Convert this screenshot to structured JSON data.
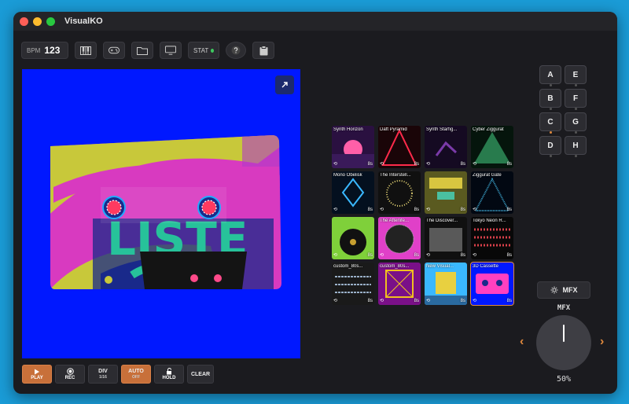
{
  "window": {
    "title": "VisualKO"
  },
  "toolbar": {
    "bpm_label": "BPM",
    "bpm_value": "123",
    "stat_label": "STAT",
    "buttons": [
      "piano-icon",
      "gamepad-icon",
      "folder-icon",
      "monitor-icon",
      "help-icon",
      "clipboard-icon"
    ]
  },
  "thumbnails": [
    {
      "name": "Synth Horizon",
      "duration": "8s",
      "colors": [
        "#2a1040",
        "#ff5fa8"
      ]
    },
    {
      "name": "Daft Pyramid",
      "duration": "8s",
      "colors": [
        "#1a0508",
        "#ff2a4a"
      ]
    },
    {
      "name": "Synth Starfig...",
      "duration": "8s",
      "colors": [
        "#150a22",
        "#7a3aa8"
      ]
    },
    {
      "name": "Cyber Ziggurat",
      "duration": "8s",
      "colors": [
        "#05150c",
        "#3fc07a"
      ]
    },
    {
      "name": "Mono Obelisk",
      "duration": "8s",
      "colors": [
        "#04101f",
        "#3ab8ff"
      ]
    },
    {
      "name": "The Interstell...",
      "duration": "8s",
      "colors": [
        "#101010",
        "#f2e07a"
      ]
    },
    {
      "name": "",
      "duration": "8s",
      "colors": [
        "#5a5a20",
        "#d8c640"
      ]
    },
    {
      "name": "Ziggurat Gate",
      "duration": "8s",
      "colors": [
        "#020812",
        "#3aa0c8"
      ]
    },
    {
      "name": "",
      "duration": "8s",
      "colors": [
        "#7fd03a",
        "#111111"
      ]
    },
    {
      "name": "The Afterlife...",
      "duration": "8s",
      "colors": [
        "#e040c8",
        "#222222"
      ]
    },
    {
      "name": "The Discover...",
      "duration": "8s",
      "colors": [
        "#101010",
        "#8a8a8a"
      ]
    },
    {
      "name": "Tokyo Neon R...",
      "duration": "8s",
      "colors": [
        "#080808",
        "#d8404a"
      ]
    },
    {
      "name": "custom_80s...",
      "duration": "8s",
      "colors": [
        "#1a1a1a",
        "#9ab0c8"
      ]
    },
    {
      "name": "custom_80s...",
      "duration": "8s",
      "colors": [
        "#7a1088",
        "#f0c020"
      ]
    },
    {
      "name": "New Visual...",
      "duration": "8s",
      "colors": [
        "#3ab8ff",
        "#e8d040"
      ]
    },
    {
      "name": "3D Cassette",
      "duration": "8s",
      "colors": [
        "#0018ff",
        "#ff40c0"
      ]
    }
  ],
  "banks": [
    "A",
    "E",
    "B",
    "F",
    "C",
    "G",
    "D",
    "H"
  ],
  "active_bank": "C",
  "mfx": {
    "button_label": "MFX",
    "label": "MFX",
    "value": "50%",
    "level": 0.5
  },
  "transport": {
    "play": {
      "label": "PLAY"
    },
    "rec": {
      "label": "REC"
    },
    "div": {
      "label": "DIV",
      "sub": "1/16"
    },
    "auto": {
      "label": "AUTO",
      "sub": "OFF"
    },
    "hold": {
      "label": "HOLD"
    },
    "clear": {
      "label": "CLEAR"
    }
  },
  "colors": {
    "accent": "#e0893d",
    "preview_bg": "#0018ff",
    "window_bg": "#1b1b1f"
  }
}
